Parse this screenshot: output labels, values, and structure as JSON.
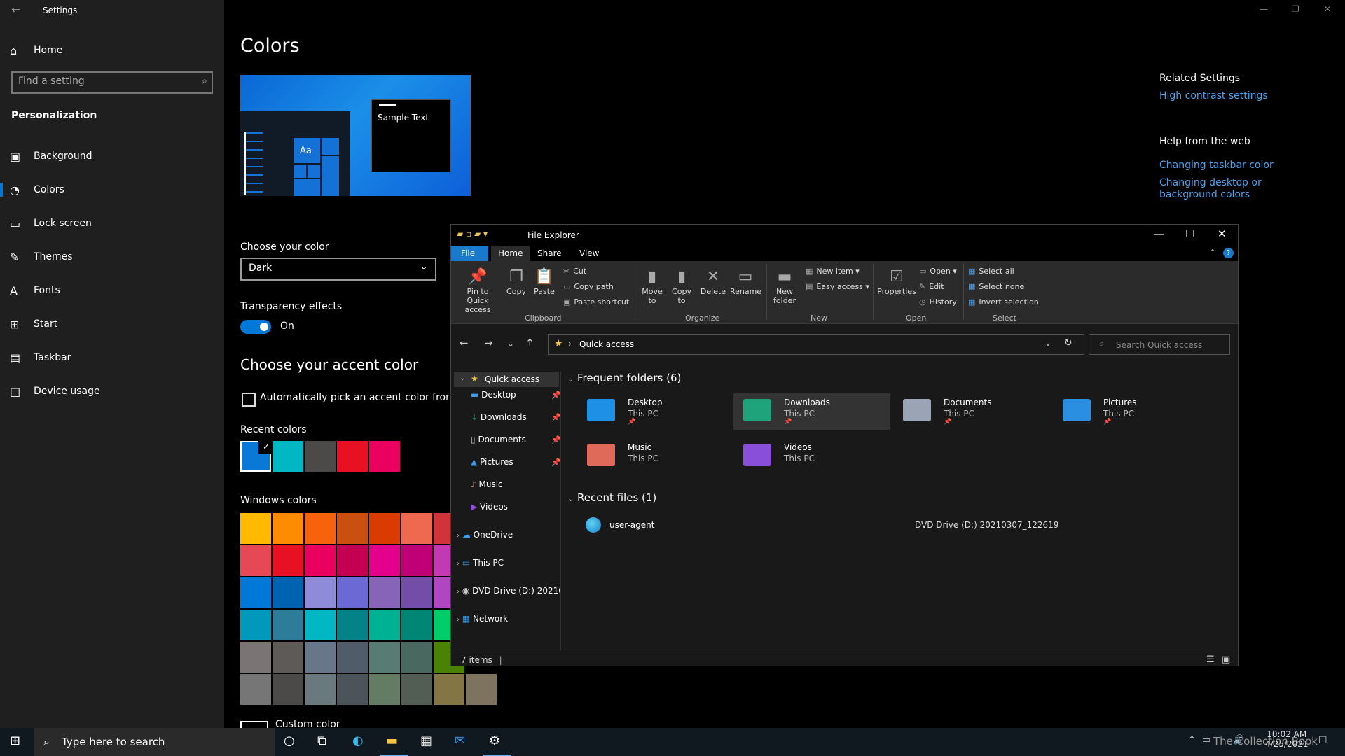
{
  "settings": {
    "window_title": "Settings",
    "home_label": "Home",
    "search_placeholder": "Find a setting",
    "section_label": "Personalization",
    "nav_items": [
      {
        "label": "Background",
        "icon": "image-icon"
      },
      {
        "label": "Colors",
        "icon": "palette-icon"
      },
      {
        "label": "Lock screen",
        "icon": "lock-screen-icon"
      },
      {
        "label": "Themes",
        "icon": "brush-icon"
      },
      {
        "label": "Fonts",
        "icon": "font-icon"
      },
      {
        "label": "Start",
        "icon": "start-icon"
      },
      {
        "label": "Taskbar",
        "icon": "taskbar-icon"
      },
      {
        "label": "Device usage",
        "icon": "device-usage-icon"
      }
    ],
    "page_title": "Colors",
    "preview_sample_text": "Sample Text",
    "preview_tile_text": "Aa",
    "choose_color_label": "Choose your color",
    "choose_color_value": "Dark",
    "transparency_label": "Transparency effects",
    "transparency_value": "On",
    "accent_heading": "Choose your accent color",
    "auto_accent_label": "Automatically pick an accent color from my",
    "recent_colors_label": "Recent colors",
    "recent_colors": [
      "#0a78d7",
      "#00b7c3",
      "#4c4a48",
      "#e81123",
      "#ea005e"
    ],
    "windows_colors_label": "Windows colors",
    "windows_colors": [
      [
        "#ffb900",
        "#ff8c00",
        "#f7630c",
        "#ca5010",
        "#da3b01",
        "#ef6950",
        "#d13438"
      ],
      [
        "#e74856",
        "#e81123",
        "#ea005e",
        "#c30052",
        "#e3008c",
        "#bf0077",
        "#c239b3"
      ],
      [
        "#0078d7",
        "#0063b1",
        "#8e8cd8",
        "#6b69d6",
        "#8764b8",
        "#744da9",
        "#b146c2"
      ],
      [
        "#0099bc",
        "#2d7d9a",
        "#00b7c3",
        "#038387",
        "#00b294",
        "#018574",
        "#00cc6a"
      ],
      [
        "#7a7574",
        "#5d5a58",
        "#68768a",
        "#515c6b",
        "#567c73",
        "#486860",
        "#498205"
      ],
      [
        "#767676",
        "#4c4a48",
        "#69797e",
        "#4a5459",
        "#647c64",
        "#525e54",
        "#847545",
        "#7e735f"
      ]
    ],
    "custom_color_label": "Custom color",
    "related_heading": "Related Settings",
    "related_link": "High contrast settings",
    "help_heading": "Help from the web",
    "help_links": [
      "Changing taskbar color",
      "Changing desktop or background colors"
    ]
  },
  "explorer": {
    "title": "File Explorer",
    "tabs": [
      "File",
      "Home",
      "Share",
      "View"
    ],
    "ribbon": {
      "clipboard": {
        "pin": "Pin to Quick access",
        "copy": "Copy",
        "paste": "Paste",
        "cut": "Cut",
        "copy_path": "Copy path",
        "paste_shortcut": "Paste shortcut",
        "group": "Clipboard"
      },
      "organize": {
        "move_to": "Move to",
        "copy_to": "Copy to",
        "delete": "Delete",
        "rename": "Rename",
        "group": "Organize"
      },
      "new": {
        "new_folder": "New folder",
        "new_item": "New item",
        "easy_access": "Easy access",
        "group": "New"
      },
      "open": {
        "properties": "Properties",
        "open": "Open",
        "edit": "Edit",
        "history": "History",
        "group": "Open"
      },
      "select": {
        "select_all": "Select all",
        "select_none": "Select none",
        "invert": "Invert selection",
        "group": "Select"
      }
    },
    "address": "Quick access",
    "search_placeholder": "Search Quick access",
    "nav": {
      "quick_access": "Quick access",
      "items": [
        "Desktop",
        "Downloads",
        "Documents",
        "Pictures",
        "Music",
        "Videos"
      ],
      "onedrive": "OneDrive",
      "this_pc": "This PC",
      "dvd": "DVD Drive (D:) 20210",
      "network": "Network"
    },
    "frequent_heading": "Frequent folders (6)",
    "folders": [
      {
        "name": "Desktop",
        "location": "This PC",
        "color": "#1e90e6"
      },
      {
        "name": "Downloads",
        "location": "This PC",
        "color": "#1fa37a"
      },
      {
        "name": "Documents",
        "location": "This PC",
        "color": "#9aa4b4"
      },
      {
        "name": "Pictures",
        "location": "This PC",
        "color": "#2a8fe0"
      },
      {
        "name": "Music",
        "location": "This PC",
        "color": "#e06a5a"
      },
      {
        "name": "Videos",
        "location": "This PC",
        "color": "#8a4fd8"
      }
    ],
    "recent_heading": "Recent files (1)",
    "recent_file": {
      "name": "user-agent",
      "location": "DVD Drive (D:) 20210307_122619"
    },
    "status": "7 items"
  },
  "taskbar": {
    "search_placeholder": "Type here to search",
    "time": "10:02 AM",
    "date": "4/25/2021",
    "watermark": "The Collection Book"
  }
}
